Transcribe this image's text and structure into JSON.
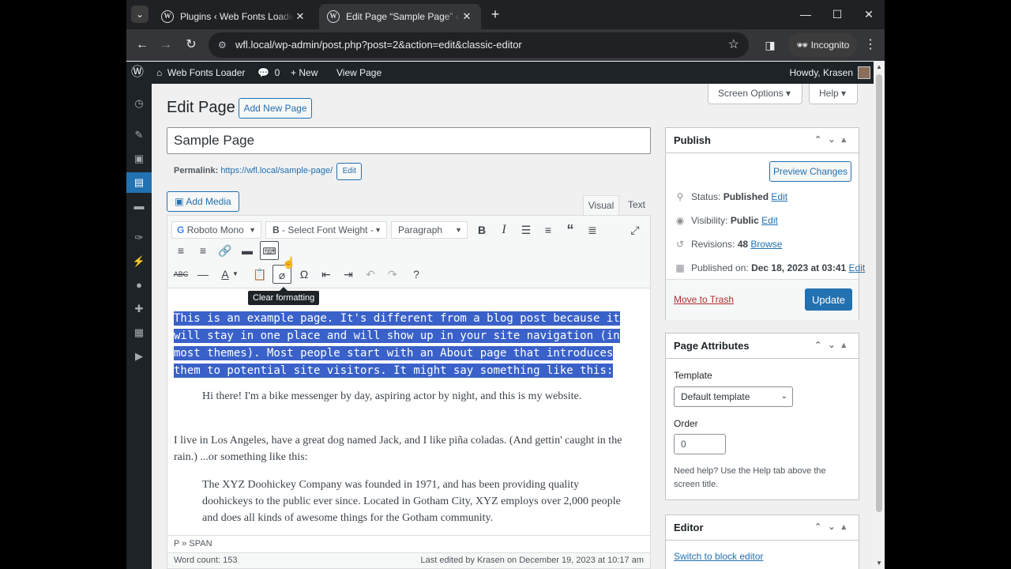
{
  "browser": {
    "tabs": [
      {
        "title": "Plugins ‹ Web Fonts Loader — W"
      },
      {
        "title": "Edit Page “Sample Page” ‹ Web"
      }
    ],
    "url": "wfl.local/wp-admin/post.php?post=2&action=edit&classic-editor",
    "incognito": "Incognito",
    "new_tab": "+"
  },
  "adminbar": {
    "site": "Web Fonts Loader",
    "comments": "0",
    "new": "New",
    "view": "View Page",
    "howdy": "Howdy, Krasen"
  },
  "screen": {
    "options": "Screen Options ▾",
    "help": "Help ▾"
  },
  "page": {
    "heading": "Edit Page",
    "add_new": "Add New Page",
    "title_value": "Sample Page",
    "permalink_label": "Permalink:",
    "permalink_url": "https://wfl.local/sample-page/",
    "permalink_edit": "Edit"
  },
  "editor": {
    "add_media": "Add Media",
    "tab_visual": "Visual",
    "tab_text": "Text",
    "font_family": "Roboto Mono",
    "font_weight": "- Select Font Weight -",
    "format": "Paragraph",
    "tooltip": "Clear formatting",
    "highlighted": "This is an example page. It's different from a blog post because it will stay in one place and will show up in your site navigation (in most themes). Most people start with an About page that introduces them to potential site visitors. It might say something like this:",
    "quote1": "Hi there! I'm a bike messenger by day, aspiring actor by night, and this is my website.",
    "para2": "I live in Los Angeles, have a great dog named Jack, and I like piña coladas. (And gettin' caught in the rain.) ...or something like this:",
    "quote2": "The XYZ Doohickey Company was founded in 1971, and has been providing quality doohickeys to the public ever since. Located in Gotham City, XYZ employs over 2,000 people and does all kinds of awesome things for the Gotham community.",
    "path": "P » SPAN",
    "word_count": "Word count: 153",
    "last_edited": "Last edited by Krasen on December 19, 2023 at 10:17 am"
  },
  "publish": {
    "title": "Publish",
    "preview": "Preview Changes",
    "status_label": "Status:",
    "status": "Published",
    "visibility_label": "Visibility:",
    "visibility": "Public",
    "revisions_label": "Revisions:",
    "revisions": "48",
    "browse": "Browse",
    "published_label": "Published on:",
    "published_on": "Dec 18, 2023 at 03:41",
    "edit": "Edit",
    "trash": "Move to Trash",
    "update": "Update"
  },
  "attributes": {
    "title": "Page Attributes",
    "template_label": "Template",
    "template": "Default template",
    "order_label": "Order",
    "order": "0",
    "help": "Need help? Use the Help tab above the screen title."
  },
  "editor_box": {
    "title": "Editor",
    "switch": "Switch to block editor"
  },
  "colors": {
    "accent": "#2271b1",
    "adminbar": "#1d2327",
    "selection": "#3961c9"
  }
}
